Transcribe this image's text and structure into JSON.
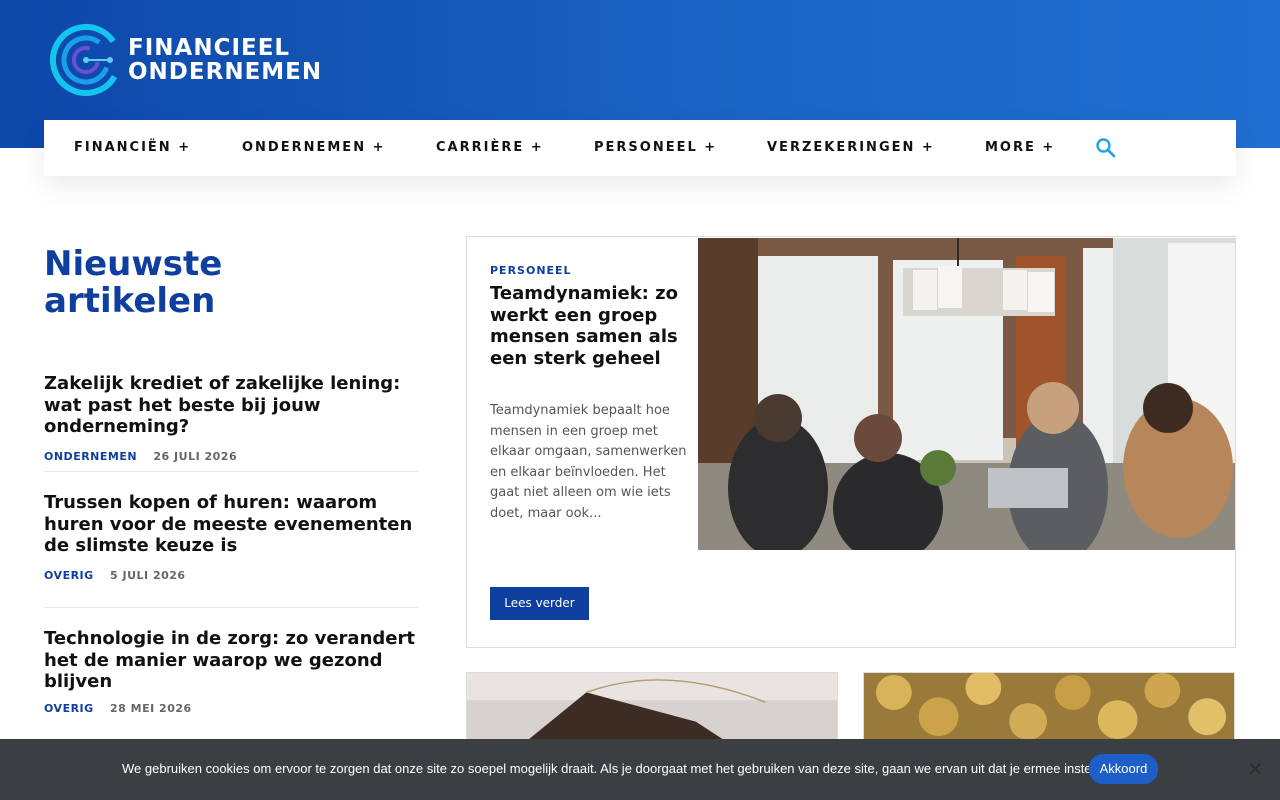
{
  "logo": {
    "line1": "FINANCIEEL",
    "line2": "ONDERNEMEN"
  },
  "nav": {
    "items": [
      "FINANCIËN +",
      "ONDERNEMEN +",
      "CARRIÈRE +",
      "PERSONEEL +",
      "VERZEKERINGEN +",
      "MORE +"
    ],
    "search_icon": "search-icon"
  },
  "sidebar": {
    "heading": "Nieuwste artikelen",
    "articles": [
      {
        "title": "Zakelijk krediet of zakelijke lening: wat past het beste bij jouw onderneming?",
        "category": "ONDERNEMEN",
        "date": "26 JULI 2026"
      },
      {
        "title": "Trussen kopen of huren: waarom huren voor de meeste evenementen de slimste keuze is",
        "category": "OVERIG",
        "date": "5 JULI 2026"
      },
      {
        "title": "Technologie in de zorg: zo verandert het de manier waarop we gezond blijven",
        "category": "OVERIG",
        "date": "28 MEI 2026"
      }
    ]
  },
  "featured": {
    "category": "PERSONEEL",
    "title": "Teamdynamiek: zo werkt een groep mensen samen als een sterk geheel",
    "excerpt": "Teamdynamiek bepaalt hoe mensen in een groep met elkaar omgaan, samenwerken en elkaar beïnvloeden. Het gaat niet alleen om wie iets doet, maar ook...",
    "button": "Lees verder"
  },
  "cookie": {
    "text": "We gebruiken cookies om ervoor te zorgen dat onze site zo soepel mogelijk draait. Als je doorgaat met het gebruiken van deze site, gaan we ervan uit dat je ermee instemt.",
    "button": "Akkoord",
    "close": "×"
  },
  "colors": {
    "brand_blue": "#0e3f9e",
    "header_blue": "#1a63c4",
    "accent": "#1e5ec9",
    "cookie_bg": "#3c3f42"
  }
}
